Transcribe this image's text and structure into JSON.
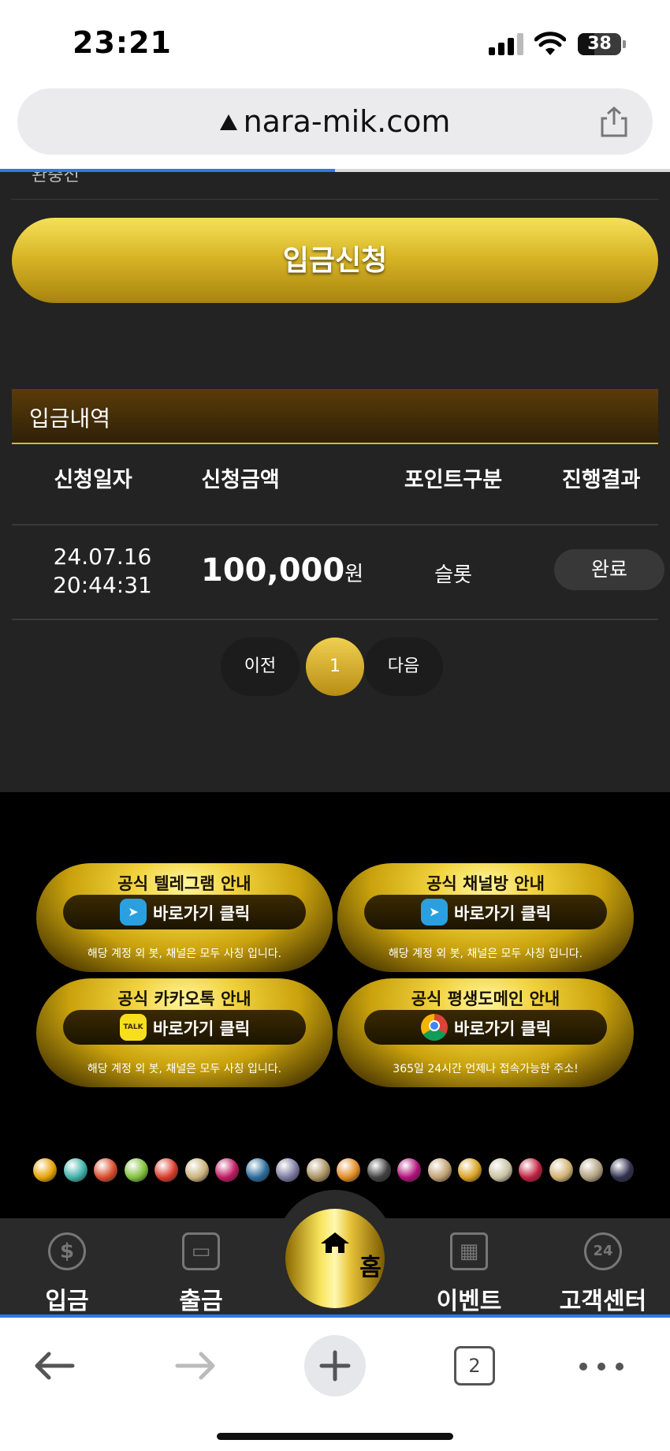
{
  "status_bar": {
    "time": "23:21",
    "battery": "38"
  },
  "browser": {
    "url": "nara-mik.com",
    "load_progress": 0.5,
    "tab_count": "2"
  },
  "page": {
    "cut_label": "완충전",
    "deposit_button": "입금신청",
    "history_title": "입금내역",
    "table": {
      "columns": [
        "신청일자",
        "신청금액",
        "포인트구분",
        "진행결과"
      ],
      "rows": [
        {
          "date": "24.07.16",
          "time": "20:44:31",
          "amount": "100,000",
          "unit": "원",
          "point_type": "슬롯",
          "status": "완료"
        }
      ]
    },
    "pager": {
      "prev": "이전",
      "current": "1",
      "next": "다음"
    }
  },
  "banners": [
    {
      "title": "공식 텔레그램 안내",
      "button": "바로가기 클릭",
      "note": "해당 계정 외 봇, 채널은 모두 사칭 입니다.",
      "icon": "telegram-icon"
    },
    {
      "title": "공식 채널방 안내",
      "button": "바로가기 클릭",
      "note": "해당 계정 외 봇, 채널은 모두 사칭 입니다.",
      "icon": "telegram-icon"
    },
    {
      "title": "공식 카카오톡 안내",
      "button": "바로가기 클릭",
      "note": "해당 계정 외 봇, 채널은 모두 사칭 입니다.",
      "icon": "kakaotalk-icon",
      "icon_text": "TALK"
    },
    {
      "title": "공식 평생도메인 안내",
      "button": "바로가기 클릭",
      "note": "365일 24시간 언제나 접속가능한 주소!",
      "icon": "chrome-icon"
    }
  ],
  "provider_logo_colors": [
    "#e6a200",
    "#3fb0a8",
    "#d84a2a",
    "#7fbf3a",
    "#d83a2a",
    "#c8b07a",
    "#c01860",
    "#2a6a9a",
    "#7a7aa0",
    "#a89060",
    "#e08a20",
    "#404040",
    "#b0107a",
    "#c0a070",
    "#d8a020",
    "#c8c0a0",
    "#c02040",
    "#d0b070",
    "#b0a080",
    "#303050"
  ],
  "tabbar": {
    "deposit": "입금",
    "withdraw": "출금",
    "home": "홈",
    "event": "이벤트",
    "support": "고객센터"
  },
  "colors": {
    "gold": "#d9b627",
    "dark_bg": "#232323",
    "accent_blue": "#2c7be5"
  }
}
